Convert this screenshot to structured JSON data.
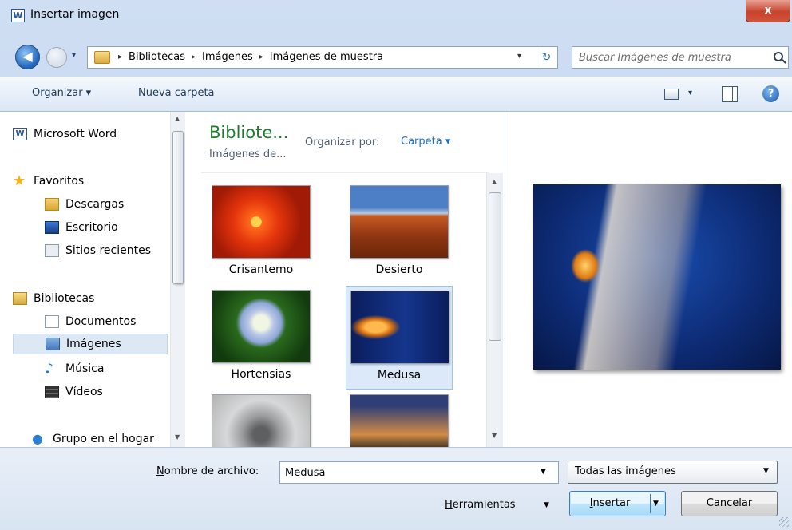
{
  "window": {
    "title": "Insertar imagen",
    "app_icon": "W",
    "close_symbol": "x"
  },
  "address": {
    "back_symbol": "◀",
    "breadcrumb": [
      "Bibliotecas",
      "Imágenes",
      "Imágenes de muestra"
    ],
    "separator": "▸",
    "dropdown_symbol": "▾",
    "refresh_symbol": "↻"
  },
  "search": {
    "placeholder": "Buscar Imágenes de muestra"
  },
  "toolbar": {
    "organize_label": "Organizar ▾",
    "new_folder_label": "Nueva carpeta",
    "views_dropdown_symbol": "▾",
    "help_symbol": "?"
  },
  "nav": {
    "items": [
      {
        "label": "Microsoft Word",
        "icon": "word-icon"
      },
      {
        "label": "Favoritos",
        "icon": "star-icon"
      },
      {
        "label": "Descargas",
        "icon": "downloads-folder-icon"
      },
      {
        "label": "Escritorio",
        "icon": "desktop-icon"
      },
      {
        "label": "Sitios recientes",
        "icon": "recent-places-icon"
      },
      {
        "label": "Bibliotecas",
        "icon": "libraries-icon"
      },
      {
        "label": "Documentos",
        "icon": "documents-icon"
      },
      {
        "label": "Imágenes",
        "icon": "pictures-icon",
        "selected": true
      },
      {
        "label": "Música",
        "icon": "music-icon"
      },
      {
        "label": "Vídeos",
        "icon": "videos-icon"
      },
      {
        "label": "Grupo en el hogar",
        "icon": "homegroup-icon"
      }
    ],
    "scroll_up": "▲",
    "scroll_down": "▼"
  },
  "content": {
    "library_title": "Bibliote...",
    "library_subtitle": "Imágenes de...",
    "sort_label": "Organizar por:",
    "sort_value": "Carpeta ▾",
    "files": [
      {
        "name": "Crisantemo",
        "thumb": "chrysanthemum-thumbnail"
      },
      {
        "name": "Desierto",
        "thumb": "desert-thumbnail"
      },
      {
        "name": "Hortensias",
        "thumb": "hydrangeas-thumbnail"
      },
      {
        "name": "Medusa",
        "thumb": "jellyfish-thumbnail",
        "selected": true
      },
      {
        "name": "",
        "thumb": "koala-thumbnail"
      },
      {
        "name": "",
        "thumb": "lighthouse-thumbnail"
      }
    ],
    "scroll_up": "▲",
    "scroll_down": "▼"
  },
  "preview": {
    "image": "jellyfish-preview"
  },
  "bottom": {
    "filename_label_underline": "N",
    "filename_label_rest": "ombre de archivo:",
    "filename_value": "Medusa",
    "filename_dropdown": "▼",
    "filter_value": "Todas las imágenes",
    "filter_dropdown": "▼",
    "tools_underline": "H",
    "tools_rest": "erramientas",
    "tools_dropdown": "▼",
    "insert_underline": "I",
    "insert_rest": "nsertar",
    "insert_dropdown": "▼",
    "cancel_label": "Cancelar"
  }
}
